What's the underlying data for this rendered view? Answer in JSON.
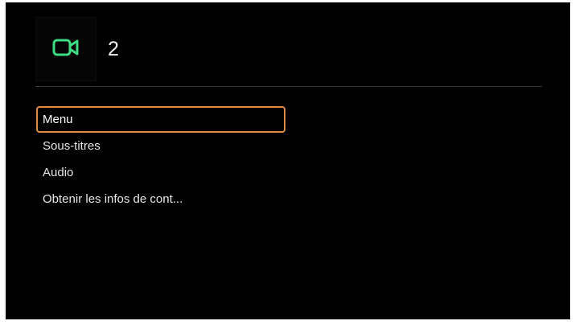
{
  "header": {
    "icon": "video-camera-icon",
    "icon_color": "#3ddc84",
    "title": "2"
  },
  "accent_color": "#e08a3c",
  "menu": {
    "selected_index": 0,
    "items": [
      {
        "label": "Menu"
      },
      {
        "label": "Sous-titres"
      },
      {
        "label": "Audio"
      },
      {
        "label": "Obtenir les infos de cont..."
      }
    ]
  }
}
